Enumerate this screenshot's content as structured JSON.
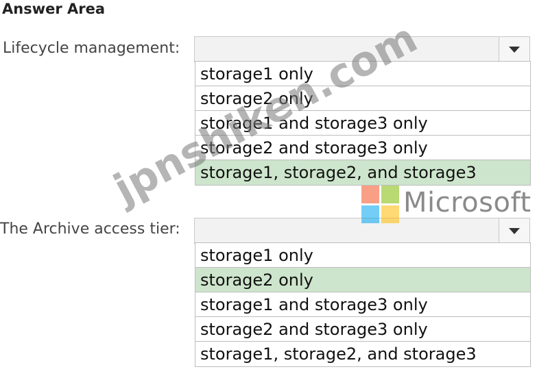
{
  "heading": "Answer Area",
  "dropdowns": [
    {
      "label": "Lifecycle management:",
      "value": "",
      "options": [
        "storage1 only",
        "storage2 only",
        "storage1 and storage3 only",
        "storage2 and storage3 only",
        "storage1, storage2, and storage3"
      ],
      "selected_index": 4
    },
    {
      "label": "The Archive access tier:",
      "value": "",
      "options": [
        "storage1 only",
        "storage2 only",
        "storage1 and storage3 only",
        "storage2 and storage3 only",
        "storage1, storage2, and storage3"
      ],
      "selected_index": 1
    }
  ],
  "logo": {
    "text": "Microsoft",
    "colors": [
      "#f25022",
      "#7fba00",
      "#00a4ef",
      "#ffb900"
    ]
  },
  "watermark": "jpnshiken.com",
  "colors": {
    "selected_bg": "#cde5cc"
  }
}
